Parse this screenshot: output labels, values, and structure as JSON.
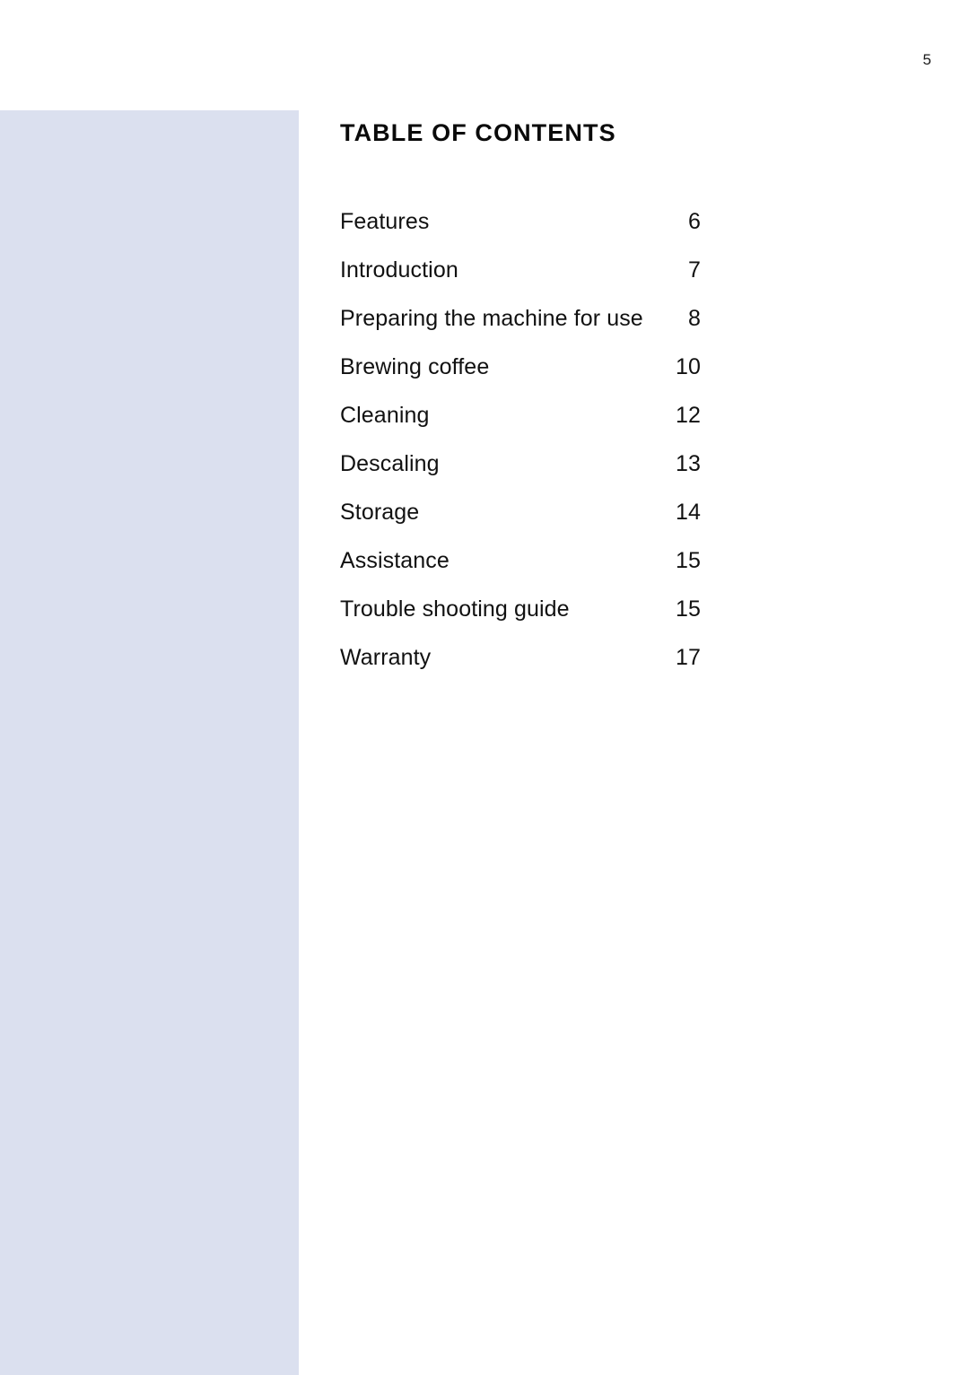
{
  "document": {
    "page_number": "5",
    "heading": "TABLE OF CONTENTS",
    "accent_color": "#dbe0ef",
    "text_color": "#111111"
  },
  "toc": {
    "entries": [
      {
        "label": "Features",
        "page": "6"
      },
      {
        "label": "Introduction",
        "page": "7"
      },
      {
        "label": "Preparing the machine for use",
        "page": "8"
      },
      {
        "label": "Brewing coffee",
        "page": "10"
      },
      {
        "label": "Cleaning",
        "page": "12"
      },
      {
        "label": "Descaling",
        "page": "13"
      },
      {
        "label": "Storage",
        "page": "14"
      },
      {
        "label": "Assistance",
        "page": "15"
      },
      {
        "label": "Trouble shooting guide",
        "page": "15"
      },
      {
        "label": "Warranty",
        "page": "17"
      }
    ]
  }
}
